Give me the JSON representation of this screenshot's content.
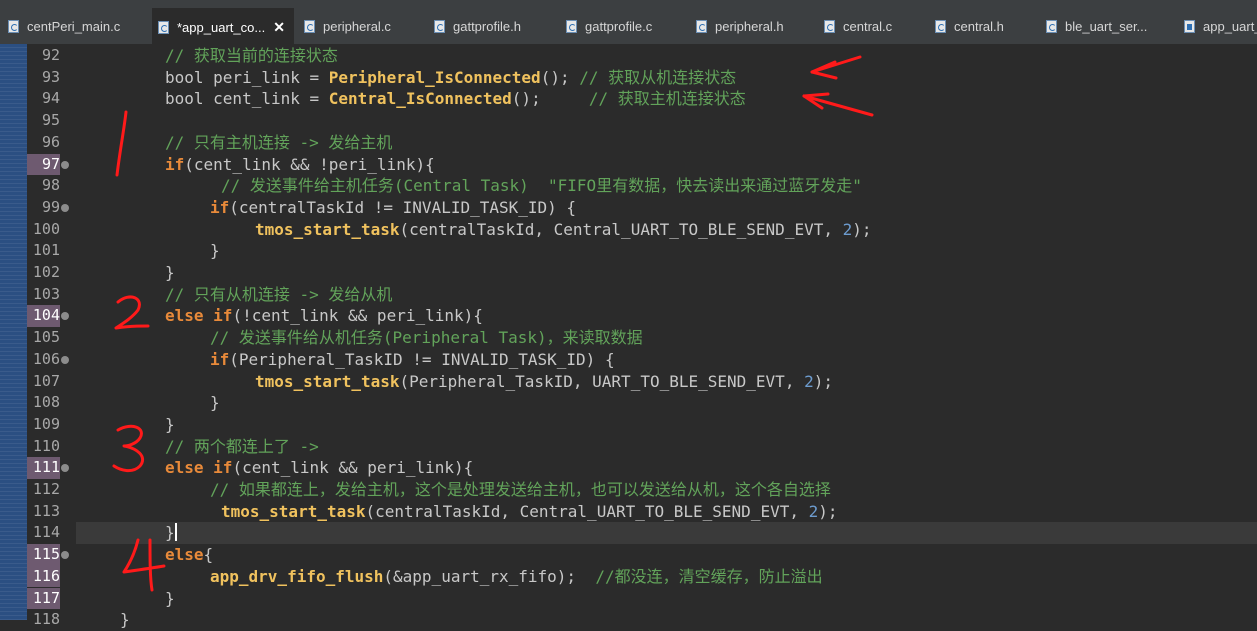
{
  "tabs": [
    {
      "label": "centPeri_main.c",
      "icon": "c-file-icon",
      "active": false
    },
    {
      "label": "*app_uart_co...",
      "icon": "c-file-icon",
      "active": true,
      "close": "✕"
    },
    {
      "label": "peripheral.c",
      "icon": "c-file-icon",
      "active": false
    },
    {
      "label": "gattprofile.h",
      "icon": "c-file-icon",
      "active": false
    },
    {
      "label": "gattprofile.c",
      "icon": "c-file-icon",
      "active": false
    },
    {
      "label": "peripheral.h",
      "icon": "c-file-icon",
      "active": false
    },
    {
      "label": "central.c",
      "icon": "c-file-icon",
      "active": false
    },
    {
      "label": "central.h",
      "icon": "c-file-icon",
      "active": false
    },
    {
      "label": "ble_uart_ser...",
      "icon": "c-file-icon",
      "active": false
    },
    {
      "label": "app_uart_",
      "icon": "h-file-icon",
      "active": false
    }
  ],
  "lines": [
    {
      "num": "92"
    },
    {
      "num": "93"
    },
    {
      "num": "94"
    },
    {
      "num": "95"
    },
    {
      "num": "96"
    },
    {
      "num": "97"
    },
    {
      "num": "98"
    },
    {
      "num": "99"
    },
    {
      "num": "100"
    },
    {
      "num": "101"
    },
    {
      "num": "102"
    },
    {
      "num": "103"
    },
    {
      "num": "104"
    },
    {
      "num": "105"
    },
    {
      "num": "106"
    },
    {
      "num": "107"
    },
    {
      "num": "108"
    },
    {
      "num": "109"
    },
    {
      "num": "110"
    },
    {
      "num": "111"
    },
    {
      "num": "112"
    },
    {
      "num": "113"
    },
    {
      "num": "114"
    },
    {
      "num": "115"
    },
    {
      "num": "116"
    },
    {
      "num": "117"
    },
    {
      "num": "118"
    }
  ],
  "code": {
    "l92": "// 获取当前的连接状态",
    "l93_kw": "bool peri_link = ",
    "l93_fn": "Peripheral_IsConnected",
    "l93_rest": "(); ",
    "l93_cm": "// 获取从机连接状态",
    "l94_kw": "bool cent_link = ",
    "l94_fn": "Central_IsConnected",
    "l94_rest": "();     ",
    "l94_cm": "// 获取主机连接状态",
    "l96": "// 只有主机连接 -> 发给主机",
    "l97_kw": "if",
    "l97_rest": "(cent_link && !peri_link){",
    "l98": "// 发送事件给主机任务(Central Task)  \"FIFO里有数据，快去读出来通过蓝牙发走\"",
    "l99_kw": "if",
    "l99_rest": "(centralTaskId != INVALID_TASK_ID) {",
    "l100_fn": "tmos_start_task",
    "l100_rest": "(centralTaskId, Central_UART_TO_BLE_SEND_EVT, ",
    "l100_num": "2",
    "l100_end": ");",
    "l101": "}",
    "l102": "}",
    "l103": "// 只有从机连接 -> 发给从机",
    "l104_kw": "else if",
    "l104_rest": "(!cent_link && peri_link){",
    "l105": "// 发送事件给从机任务(Peripheral Task)，来读取数据",
    "l106_kw": "if",
    "l106_rest": "(Peripheral_TaskID != INVALID_TASK_ID) {",
    "l107_fn": "tmos_start_task",
    "l107_rest": "(Peripheral_TaskID, UART_TO_BLE_SEND_EVT, ",
    "l107_num": "2",
    "l107_end": ");",
    "l108": "}",
    "l109": "}",
    "l110": "// 两个都连上了 ->",
    "l111_kw": "else if",
    "l111_rest": "(cent_link && peri_link){",
    "l112": "// 如果都连上，发给主机，这个是处理发送给主机，也可以发送给从机，这个各自选择",
    "l113_fn": "tmos_start_task",
    "l113_rest": "(centralTaskId, Central_UART_TO_BLE_SEND_EVT, ",
    "l113_num": "2",
    "l113_end": ");",
    "l114": "}",
    "l115_kw": "else",
    "l115_rest": "{",
    "l116_fn": "app_drv_fifo_flush",
    "l116_rest": "(&app_uart_rx_fifo);  ",
    "l116_cm": "//都没连，清空缓存，防止溢出",
    "l117": "}",
    "l118": "}"
  },
  "annotations": {
    "color": "#ff1a1a",
    "numbers": [
      "1",
      "2",
      "3",
      "4"
    ],
    "arrows": 2
  }
}
